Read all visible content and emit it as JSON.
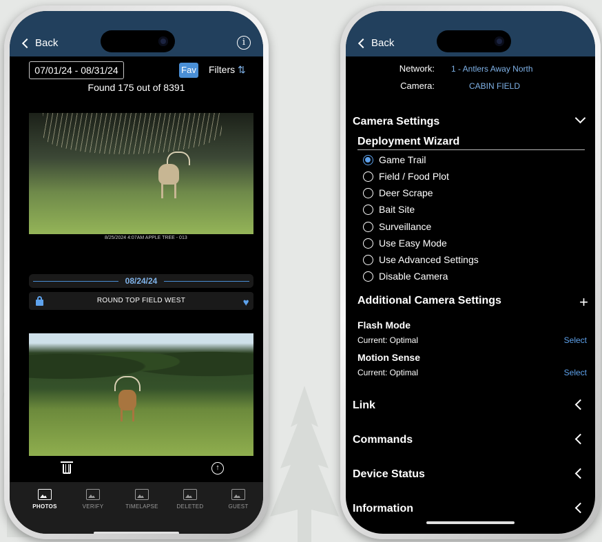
{
  "left_phone": {
    "nav": {
      "back_label": "Back"
    },
    "date_range": "07/01/24 - 08/31/24",
    "fav_label": "Fav",
    "filters_label": "Filters",
    "found_text": "Found 175 out of 8391",
    "photo1_strip": "8/25/2024   4:07AM   APPLE TREE - 013",
    "date_divider": "08/24/24",
    "camera_name": "ROUND TOP FIELD WEST",
    "tabs": [
      {
        "label": "PHOTOS",
        "icon": "photos-icon",
        "active": true
      },
      {
        "label": "VERIFY",
        "icon": "verify-icon",
        "active": false
      },
      {
        "label": "TIMELAPSE",
        "icon": "timelapse-icon",
        "active": false
      },
      {
        "label": "DELETED",
        "icon": "deleted-icon",
        "active": false
      },
      {
        "label": "GUEST",
        "icon": "guest-icon",
        "active": false
      }
    ]
  },
  "right_phone": {
    "nav": {
      "back_label": "Back"
    },
    "network_key": "Network:",
    "network_value": "1 - Antlers Away North",
    "camera_key": "Camera:",
    "camera_value": "CABIN FIELD",
    "camera_settings_title": "Camera Settings",
    "wizard_title": "Deployment Wizard",
    "wizard_options": [
      {
        "label": "Game Trail",
        "selected": true
      },
      {
        "label": "Field / Food Plot",
        "selected": false
      },
      {
        "label": "Deer Scrape",
        "selected": false
      },
      {
        "label": "Bait Site",
        "selected": false
      },
      {
        "label": "Surveillance",
        "selected": false
      },
      {
        "label": "Use Easy Mode",
        "selected": false
      },
      {
        "label": "Use Advanced Settings",
        "selected": false
      },
      {
        "label": "Disable Camera",
        "selected": false
      }
    ],
    "additional_title": "Additional Camera Settings",
    "flash_mode": {
      "name": "Flash Mode",
      "current": "Current:  Optimal",
      "select": "Select"
    },
    "motion_sense": {
      "name": "Motion Sense",
      "current": "Current:  Optimal",
      "select": "Select"
    },
    "sections": [
      "Link",
      "Commands",
      "Device Status",
      "Information"
    ]
  },
  "colors": {
    "header": "#22405d",
    "accent": "#4a8fd6",
    "link": "#7fb2e8"
  }
}
